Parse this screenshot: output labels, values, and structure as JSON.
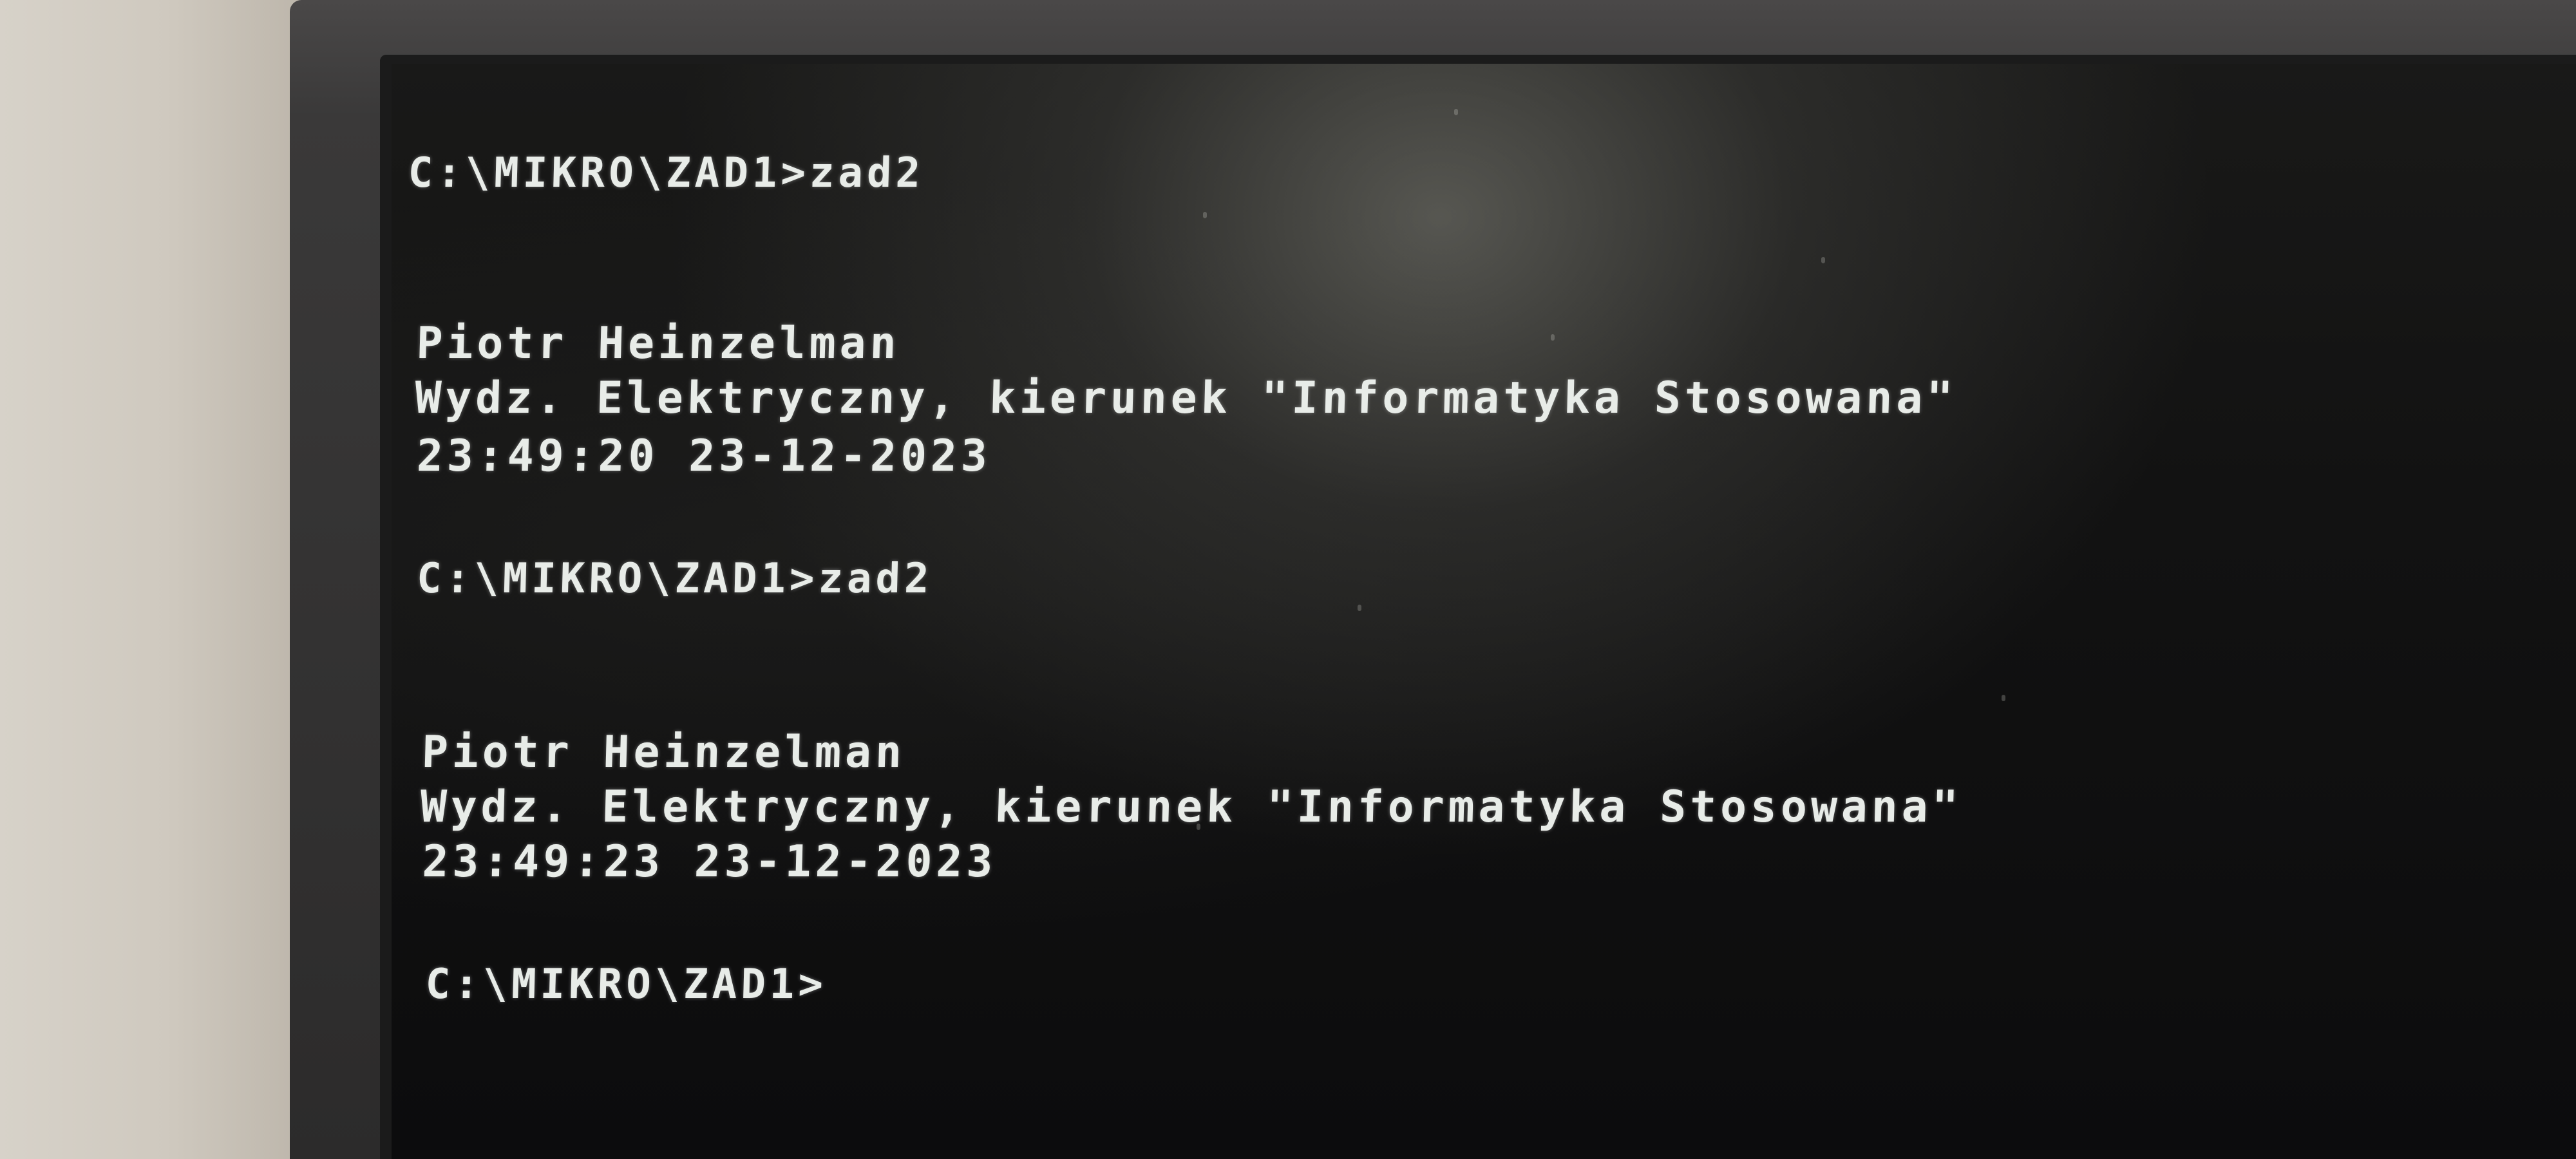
{
  "terminal": {
    "lines": [
      {
        "text": "C:\\MIKRO\\ZAD1>zad2"
      },
      {
        "text": "Piotr Heinzelman"
      },
      {
        "text": "Wydz. Elektryczny, kierunek \"Informatyka Stosowana\""
      },
      {
        "text": "23:49:20 23-12-2023"
      },
      {
        "text": "C:\\MIKRO\\ZAD1>zad2"
      },
      {
        "text": "Piotr Heinzelman"
      },
      {
        "text": "Wydz. Elektryczny, kierunek \"Informatyka Stosowana\""
      },
      {
        "text": "23:49:23 23-12-2023"
      },
      {
        "text": "C:\\MIKRO\\ZAD1>"
      }
    ]
  },
  "colors": {
    "screen_text": "#e8ece8",
    "screen_background": "#0c0c0d",
    "bezel": "#2c2b2b"
  }
}
